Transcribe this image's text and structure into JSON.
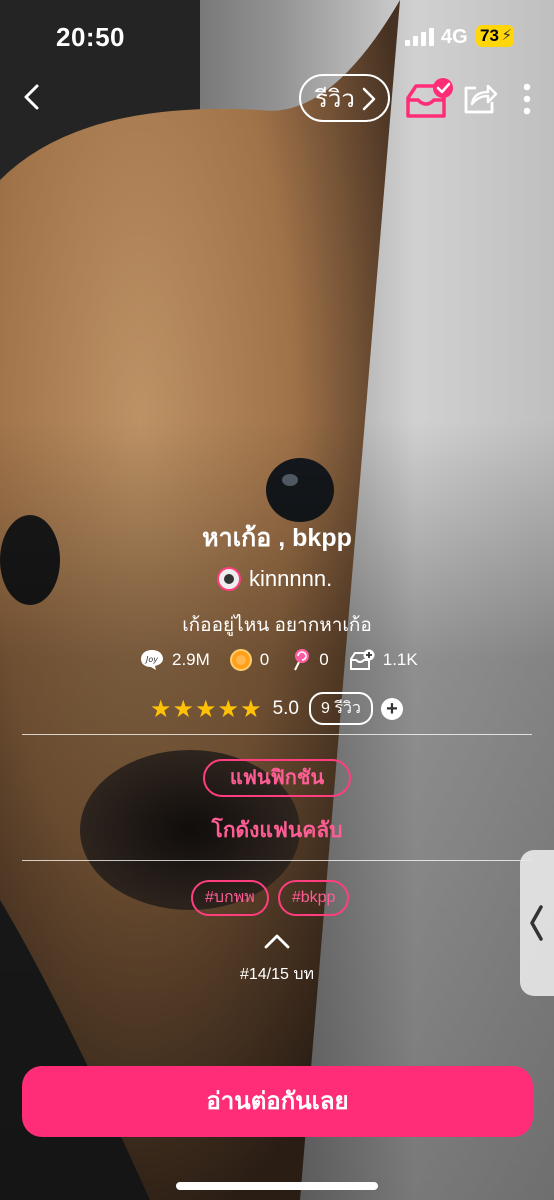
{
  "status_bar": {
    "time": "20:50",
    "network": "4G",
    "battery": "73"
  },
  "header": {
    "review_button": "รีวิว"
  },
  "story": {
    "title": "หาเก้อ , bkpp",
    "author": "kinnnnn.",
    "description": "เก้ออยู่ไหน อยากหาเก้อ",
    "stats": {
      "views": "2.9M",
      "coins": "0",
      "candies": "0",
      "shelf_adds": "1.1K"
    },
    "rating": {
      "stars": "★★★★★",
      "score": "5.0",
      "review_count_label": "9 รีวิว"
    },
    "category": "แฟนฟิกชัน",
    "subcategory": "โกดังแฟนคลับ",
    "tags": [
      "#บกพพ",
      "#bkpp"
    ],
    "chapter_progress": "#14/15 บท"
  },
  "cta": {
    "label": "อ่านต่อกันเลย"
  },
  "colors": {
    "accent": "#ff2d78",
    "star": "#ffc107",
    "battery": "#ffd60a"
  },
  "icons": [
    "back-chevron-icon",
    "chevron-right-icon",
    "shelf-check-icon",
    "share-icon",
    "more-vertical-icon",
    "joy-icon",
    "coin-icon",
    "lollipop-icon",
    "shelf-add-icon",
    "plus-icon",
    "chevron-up-icon",
    "chevron-left-icon"
  ]
}
